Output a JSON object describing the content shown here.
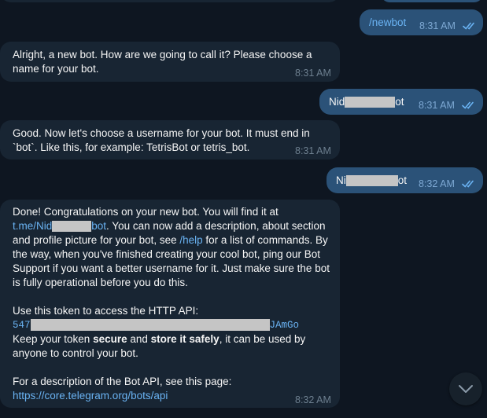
{
  "messages": [
    {
      "id": "out-1",
      "text": "/newbot",
      "time": "8:31 AM"
    },
    {
      "id": "in-1",
      "lines": [
        "Alright, a new bot. How are we going to call it? Please choose a",
        "name for your bot."
      ],
      "time": "8:31 AM"
    },
    {
      "id": "out-2",
      "text_start": "Nid",
      "text_end": "ot",
      "time": "8:31 AM"
    },
    {
      "id": "in-2",
      "lines": [
        "Good. Now let's choose a username for your bot. It must end in",
        "`bot`. Like this, for example: TetrisBot or tetris_bot."
      ],
      "time": "8:31 AM"
    },
    {
      "id": "out-3",
      "text_start": "Ni",
      "text_end": "ot",
      "time": "8:32 AM"
    },
    {
      "id": "in-3",
      "line1": "Done! Congratulations on your new bot. You will find it at",
      "link_start": "t.me/Nid",
      "link_end": "bot",
      "line2_rest": ". You can now add a description, about section",
      "line3": "and profile picture for your bot, see ",
      "help_link": "/help",
      "line3_rest": " for a list of commands. By",
      "line4": "the way, when you've finished creating your cool bot, ping our Bot",
      "line5": "Support if you want a better username for it. Just make sure the bot",
      "line6": "is fully operational before you do this.",
      "token_intro": "Use this token to access the HTTP API:",
      "token_start": "547",
      "token_end": "JAmGo",
      "keep_1": "Keep your token ",
      "keep_bold1": "secure",
      "keep_2": " and ",
      "keep_bold2": "store it safely",
      "keep_3": ", it can be used by",
      "keep_line2": "anyone to control your bot.",
      "desc_line": "For a description of the Bot API, see this page:",
      "api_link": "https://core.telegram.org/bots/api",
      "time": "8:32 AM"
    }
  ],
  "icons": {
    "read_checks": "double-check-icon",
    "scroll_down": "chevron-down-icon"
  },
  "colors": {
    "background": "#0e1621",
    "incoming_bubble": "#182533",
    "outgoing_bubble": "#2b5278",
    "link": "#6ab3f3"
  }
}
